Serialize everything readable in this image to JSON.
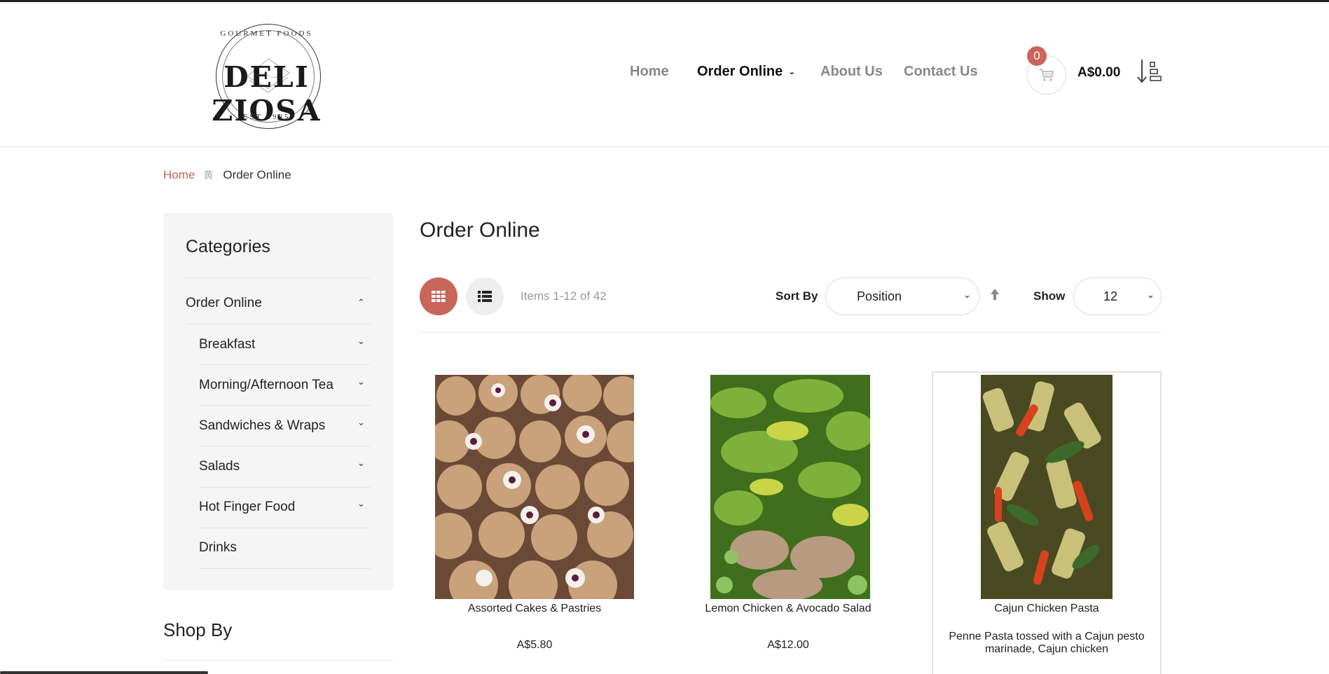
{
  "brand": {
    "name": "DELI ZIOSA",
    "tagline": "GOURMET FOODS",
    "est": "EST 1995"
  },
  "nav": {
    "home": "Home",
    "order_online": "Order Online",
    "about": "About Us",
    "contact": "Contact Us"
  },
  "cart": {
    "count": "0",
    "total": "A$0.00"
  },
  "breadcrumb": {
    "home": "Home",
    "current": "Order Online"
  },
  "sidebar": {
    "title": "Categories",
    "items": [
      {
        "label": "Order Online"
      },
      {
        "label": "Breakfast"
      },
      {
        "label": "Morning/Afternoon Tea"
      },
      {
        "label": "Sandwiches & Wraps"
      },
      {
        "label": "Salads"
      },
      {
        "label": "Hot Finger Food"
      },
      {
        "label": "Drinks"
      }
    ],
    "shop_by": "Shop By"
  },
  "main": {
    "title": "Order Online",
    "items_count": "Items 1-12 of 42",
    "sort_label": "Sort By",
    "sort_value": "Position",
    "show_label": "Show",
    "show_value": "12"
  },
  "products": [
    {
      "name": "Assorted Cakes & Pastries",
      "price": "A$5.80"
    },
    {
      "name": "Lemon Chicken & Avocado Salad",
      "price": "A$12.00"
    },
    {
      "name": "Cajun Chicken Pasta",
      "desc": "Penne Pasta tossed with a Cajun pesto marinade, Cajun chicken"
    }
  ],
  "colors": {
    "accent": "#c9655a",
    "nav_inactive": "#888888",
    "sidebar_bg": "#f5f5f5"
  }
}
